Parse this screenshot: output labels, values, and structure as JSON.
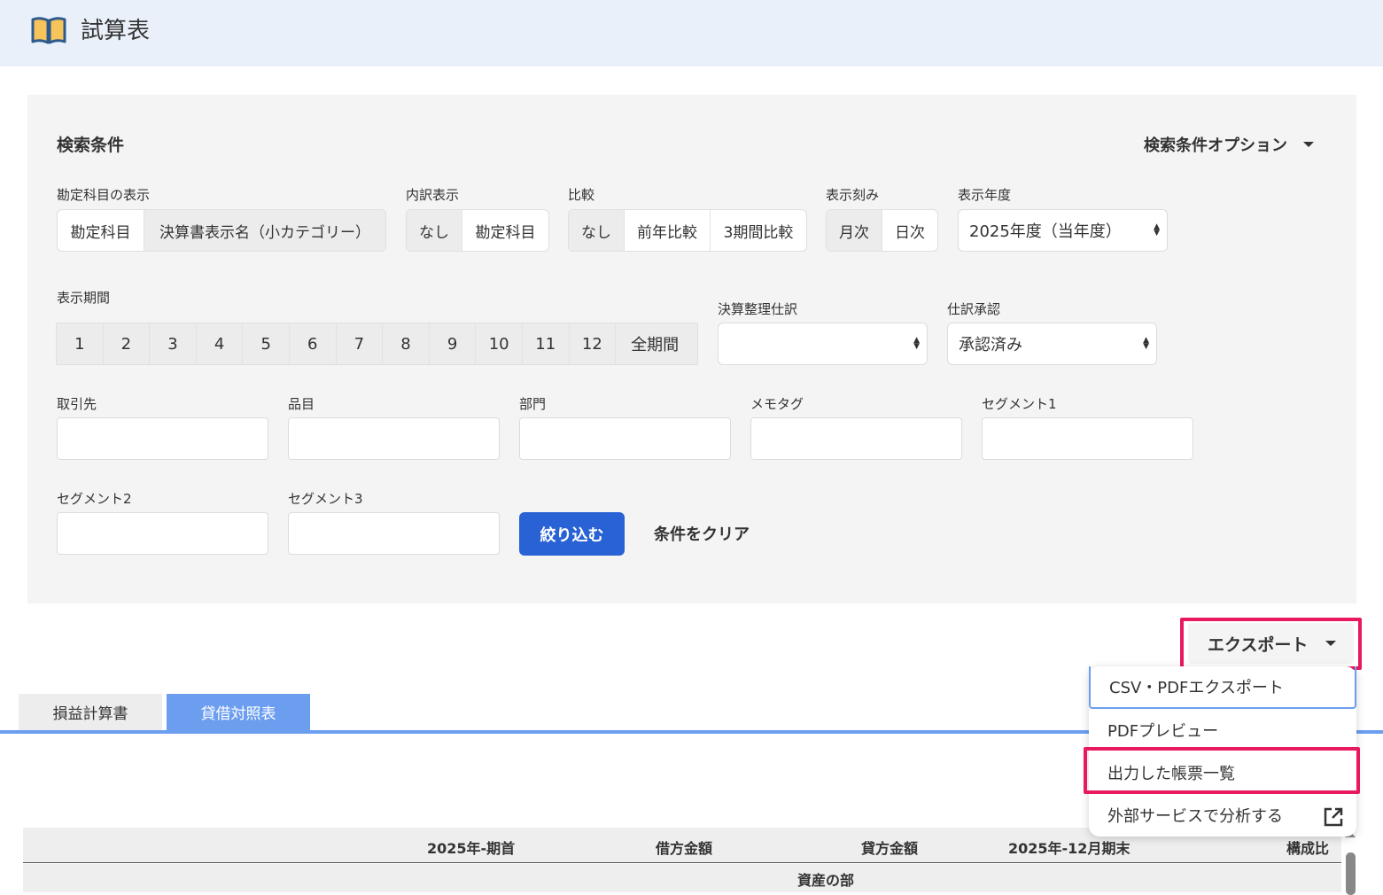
{
  "header": {
    "title": "試算表",
    "icon": "book-icon"
  },
  "search": {
    "title": "検索条件",
    "options_label": "検索条件オプション",
    "account_display": {
      "label": "勘定科目の表示",
      "options": [
        "勘定科目",
        "決算書表示名（小カテゴリー）"
      ],
      "selected": 1
    },
    "breakdown": {
      "label": "内訳表示",
      "options": [
        "なし",
        "勘定科目"
      ],
      "selected": 0
    },
    "comparison": {
      "label": "比較",
      "options": [
        "なし",
        "前年比較",
        "3期間比較"
      ],
      "selected": 0
    },
    "granularity": {
      "label": "表示刻み",
      "options": [
        "月次",
        "日次"
      ],
      "selected": 0
    },
    "fiscal_year": {
      "label": "表示年度",
      "value": "2025年度（当年度）"
    },
    "period": {
      "label": "表示期間",
      "options": [
        "1",
        "2",
        "3",
        "4",
        "5",
        "6",
        "7",
        "8",
        "9",
        "10",
        "11",
        "12",
        "全期間"
      ]
    },
    "closing_entries": {
      "label": "決算整理仕訳",
      "value": ""
    },
    "approval": {
      "label": "仕訳承認",
      "value": "承認済み"
    },
    "fields": {
      "partner": "取引先",
      "item": "品目",
      "department": "部門",
      "memo_tag": "メモタグ",
      "segment1": "セグメント1",
      "segment2": "セグメント2",
      "segment3": "セグメント3"
    },
    "filter_button": "絞り込む",
    "clear_button": "条件をクリア"
  },
  "export": {
    "button_label": "エクスポート",
    "menu": {
      "csv_pdf": "CSV・PDFエクスポート",
      "pdf_preview": "PDFプレビュー",
      "output_list": "出力した帳票一覧",
      "external": "外部サービスで分析する"
    }
  },
  "tabs": {
    "pl": "損益計算書",
    "bs": "貸借対照表",
    "active": "bs"
  },
  "table": {
    "columns": [
      "2025年-期首",
      "借方金額",
      "貸方金額",
      "2025年-12月期末",
      "構成比"
    ],
    "section": "資産の部"
  },
  "colors": {
    "accent": "#2962d5",
    "tab_active": "#6c9ef0",
    "highlight": "#e8195c",
    "header_bg": "#e9f0fa"
  }
}
